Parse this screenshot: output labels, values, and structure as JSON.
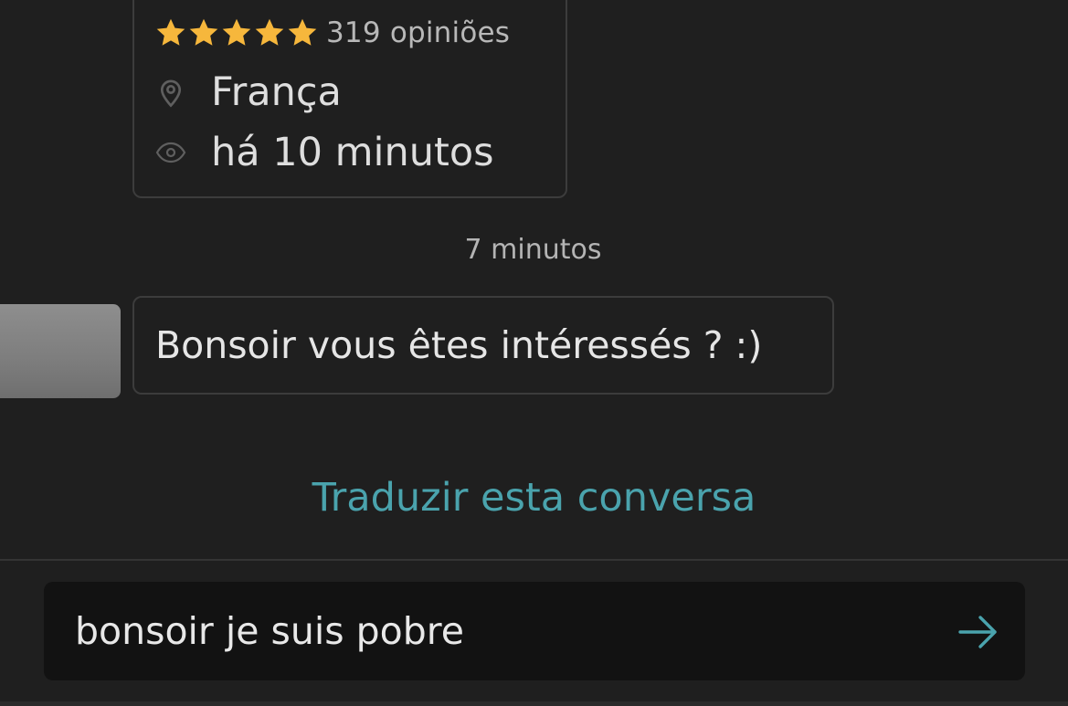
{
  "profile": {
    "rating_stars": 5,
    "review_count": "319 opiniões",
    "location_icon": "location-pin-icon",
    "location": "França",
    "seen_icon": "eye-icon",
    "last_seen": "há 10 minutos"
  },
  "conversation": {
    "timestamp": "7 minutos",
    "messages": [
      {
        "text": "Bonsoir vous êtes intéressés ? :)"
      }
    ],
    "translate_label": "Traduzir esta conversa"
  },
  "composer": {
    "value": "bonsoir je suis pobre",
    "send_icon": "arrow-right-icon"
  },
  "colors": {
    "background": "#1f1f1f",
    "star": "#f6b73c",
    "accent": "#4aa3ad",
    "card_border": "#3c3c3c",
    "input_background": "#121212"
  }
}
